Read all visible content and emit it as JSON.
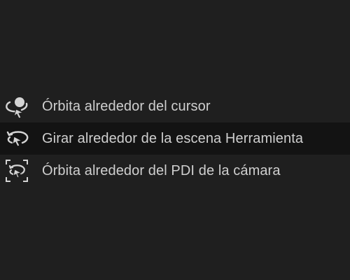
{
  "menu": {
    "items": [
      {
        "label": "Órbita alrededor del cursor",
        "icon": "orbit-cursor-icon",
        "selected": false
      },
      {
        "label": "Girar alrededor de la escena Herramienta",
        "icon": "rotate-scene-icon",
        "selected": true
      },
      {
        "label": "Órbita alrededor del PDI de la cámara",
        "icon": "orbit-camera-poi-icon",
        "selected": false
      }
    ]
  },
  "colors": {
    "background": "#1f1f1f",
    "selected_background": "#131313",
    "text": "#cfcfcf",
    "icon": "#d4d4d4"
  }
}
